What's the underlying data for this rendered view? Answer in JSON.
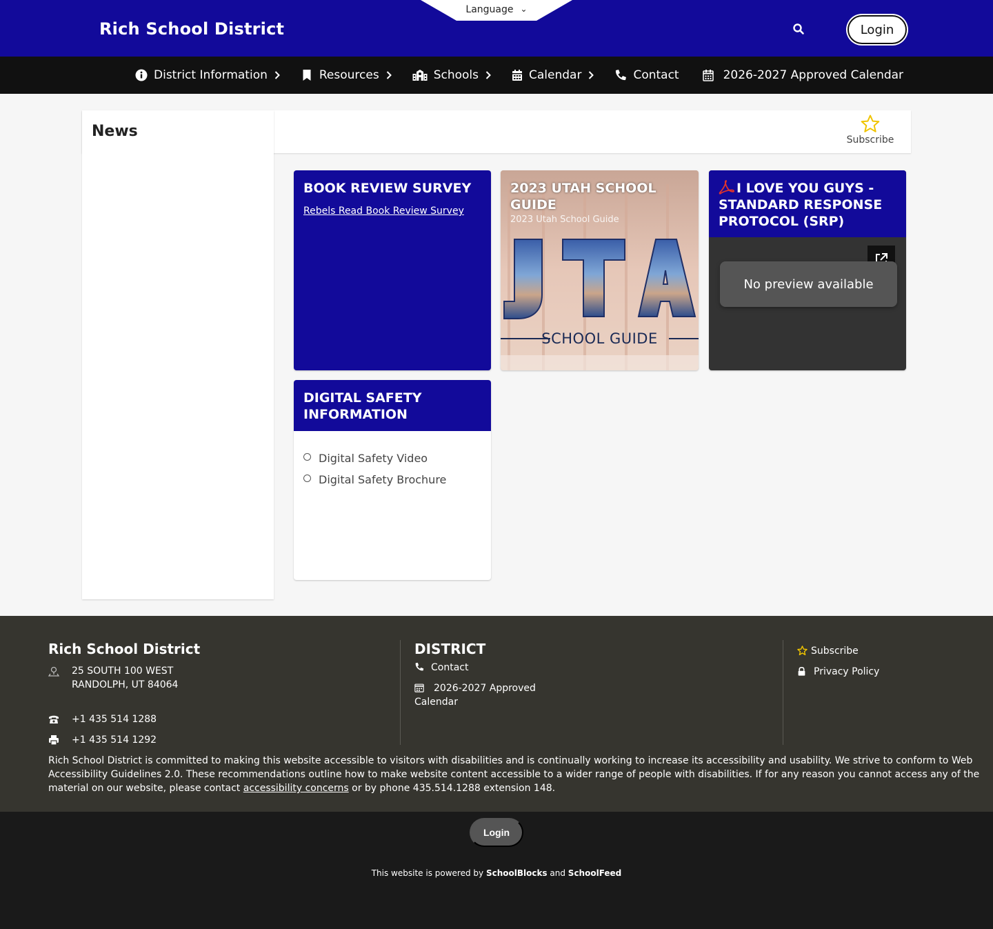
{
  "header": {
    "site_title": "Rich School District",
    "language_label": "Language",
    "login_label": "Login"
  },
  "nav": {
    "items": [
      {
        "label": "District Information",
        "icon": "info-circle-icon"
      },
      {
        "label": "Resources",
        "icon": "bookmark-icon"
      },
      {
        "label": "Schools",
        "icon": "school-building-icon"
      },
      {
        "label": "Calendar",
        "icon": "calendar-icon"
      },
      {
        "label": "Contact",
        "icon": "phone-icon"
      },
      {
        "label": "2026-2027 Approved Calendar",
        "icon": "calendar-grid-icon"
      }
    ]
  },
  "main": {
    "title": "News",
    "subscribe_label": "Subscribe",
    "cards": [
      {
        "title": "BOOK REVIEW SURVEY",
        "link": "Rebels Read Book Review Survey"
      },
      {
        "title": "2023 UTAH SCHOOL GUIDE",
        "subtitle": "2023 Utah School Guide",
        "image_text": "SCHOOL GUIDE"
      },
      {
        "title": "I LOVE YOU GUYS - STANDARD RESPONSE PROTOCOL (SRP)",
        "preview_text": "No preview available"
      },
      {
        "title": "DIGITAL SAFETY INFORMATION",
        "items": [
          "Digital Safety Video",
          "Digital Safety Brochure"
        ]
      }
    ]
  },
  "footer": {
    "org_name": "Rich School District",
    "address_line1": "25 SOUTH 100 WEST",
    "address_line2": "RANDOLPH, UT 84064",
    "phone": "+1 435 514 1288",
    "fax": "+1 435 514 1292",
    "district_heading": "DISTRICT",
    "district_links": [
      "Contact",
      "2026-2027 Approved",
      "Calendar"
    ],
    "right_links": [
      "Subscribe",
      "Privacy Policy"
    ],
    "disclaimer_before": "Rich School District is committed to making this website accessible to visitors with disabilities and is continually working to increase its accessibility and usability. We strive to conform to Web Accessibility Guidelines 2.0. These recommendations outline how to make website content accessible to a wider range of people with disabilities. If for any reason you cannot access any of the material on our website, please contact ",
    "disclaimer_link": "accessibility concerns",
    "disclaimer_after": " or by phone 435.514.1288 extension 148."
  },
  "bottom": {
    "login_label": "Login",
    "powered_prefix": "This website is powered by ",
    "brand1": "SchoolBlocks",
    "and": " and ",
    "brand2": "SchoolFeed"
  },
  "colors": {
    "brand_blue": "#120a9a",
    "nav_black": "#111111",
    "footer_bg": "#36352f",
    "star_yellow": "#f0c400",
    "pdf_red": "#e0342c"
  }
}
